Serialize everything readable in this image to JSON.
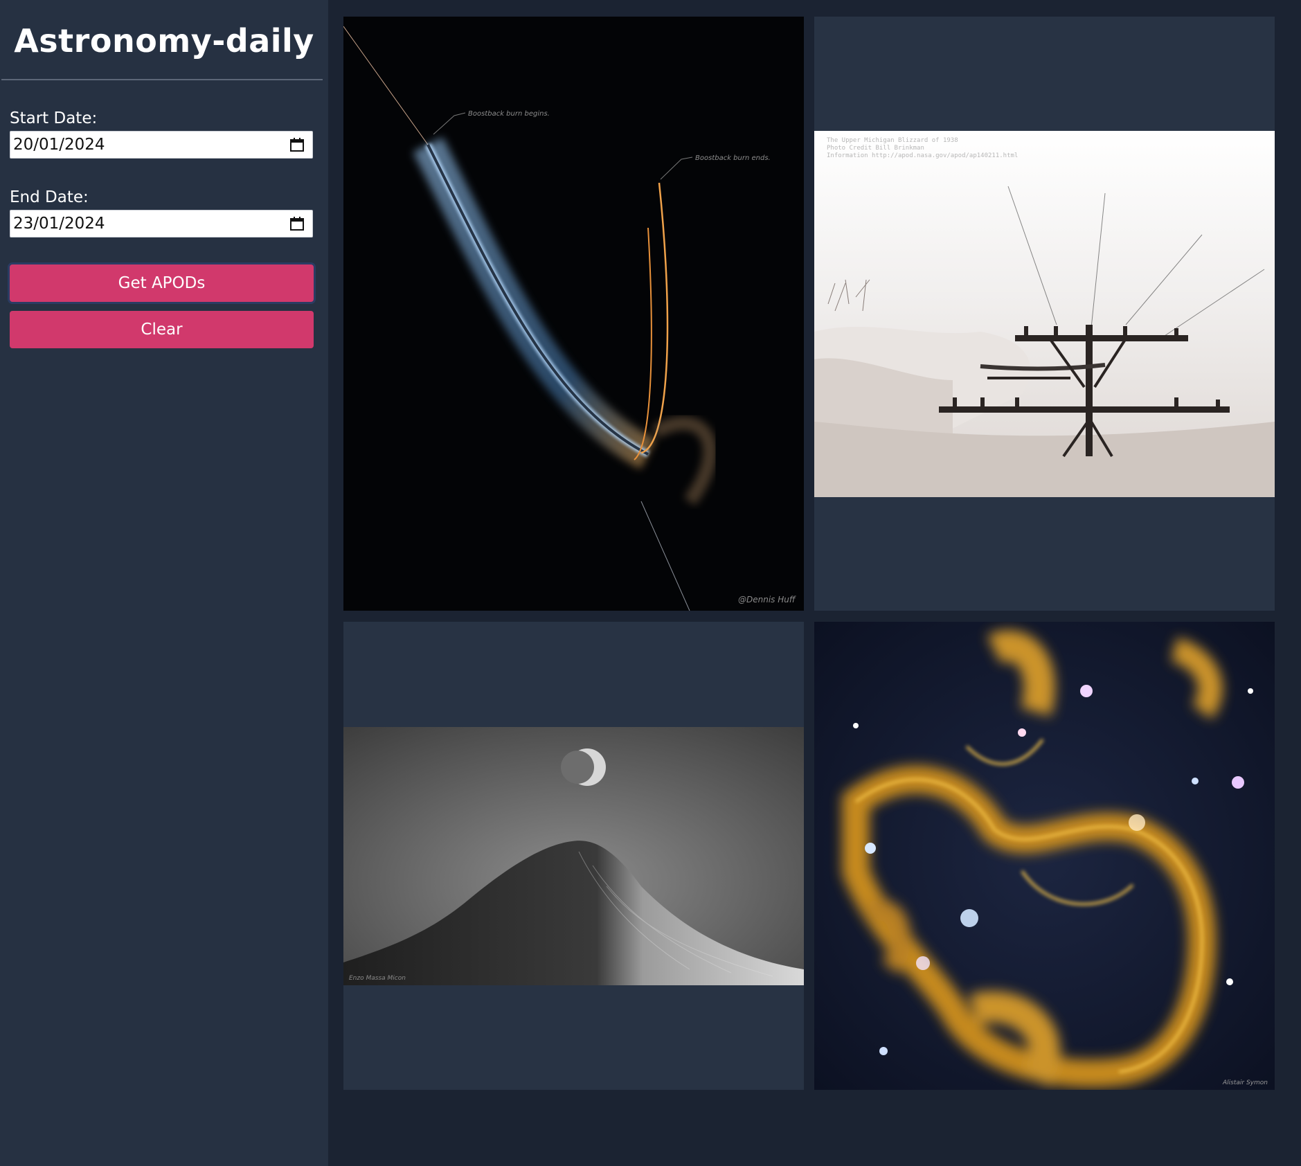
{
  "app": {
    "title": "Astronomy-daily"
  },
  "form": {
    "start_label": "Start Date:",
    "start_value": "20/01/2024",
    "end_label": "End Date:",
    "end_value": "23/01/2024",
    "get_button": "Get APODs",
    "clear_button": "Clear"
  },
  "gallery": {
    "items": [
      {
        "subject": "rocket boostback burn trail",
        "labels": [
          "Boostback burn begins.",
          "Boostback burn ends."
        ],
        "credit": "@Dennis Huff"
      },
      {
        "subject": "snow buried telephone pole",
        "caption_lines": [
          "The Upper Michigan Blizzard of 1938",
          "Photo Credit  Bill Brinkman",
          "Information  http://apod.nasa.gov/apod/ap140211.html"
        ]
      },
      {
        "subject": "moon over mountain peak",
        "credit": "Enzo Massa Micon"
      },
      {
        "subject": "colorful nebula field",
        "credit": "Alistair Symon"
      }
    ]
  },
  "colors": {
    "sidebar": "#263142",
    "background": "#1b2332",
    "card": "#283344",
    "button": "#d1396c"
  }
}
